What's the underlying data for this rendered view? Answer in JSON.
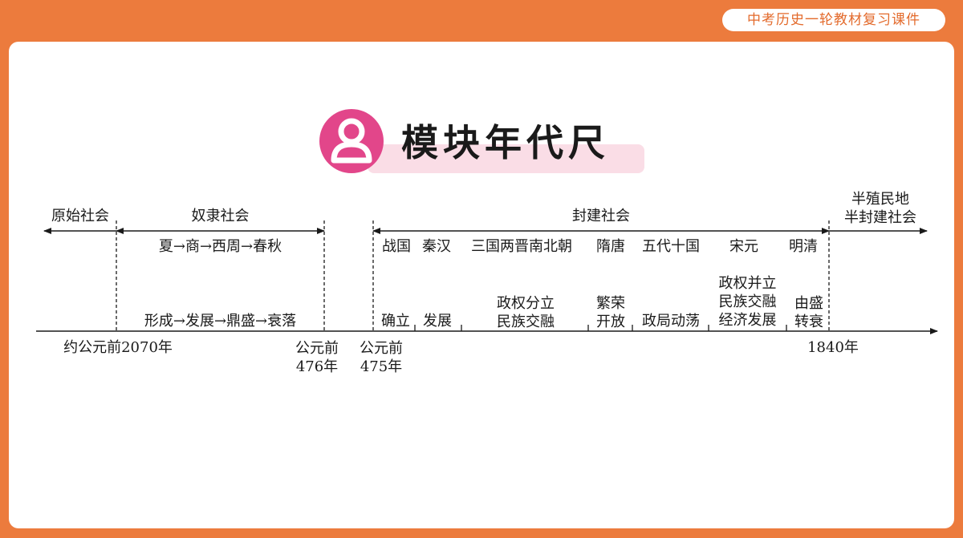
{
  "header": {
    "course_title": "中考历史一轮教材复习课件"
  },
  "module": {
    "icon": "person-icon",
    "title": "模块年代尺"
  },
  "timeline": {
    "societies": {
      "primitive": "原始社会",
      "slave": "奴隶社会",
      "feudal": "封建社会",
      "semi_colonial": [
        "半殖民地",
        "半封建社会"
      ]
    },
    "slave_dynasties": "夏→商→西周→春秋",
    "slave_stages": "形成→发展→鼎盛→衰落",
    "feudal_periods": [
      "战国",
      "秦汉",
      "三国两晋南北朝",
      "隋唐",
      "五代十国",
      "宋元",
      "明清"
    ],
    "feudal_stages": {
      "establish": "确立",
      "develop": "发展",
      "division": [
        "政权分立",
        "民族交融"
      ],
      "prosperity": [
        "繁荣",
        "开放"
      ],
      "turmoil": "政局动荡",
      "coexist": [
        "政权并立",
        "民族交融",
        "经济发展"
      ],
      "decline": [
        "由盛",
        "转衰"
      ]
    },
    "dates": {
      "start": "约公元前2070年",
      "bc476": [
        "公元前",
        "476年"
      ],
      "bc475": [
        "公元前",
        "475年"
      ],
      "ad1840": "1840年"
    }
  },
  "colors": {
    "frame": "#EC7B3D",
    "accent_pink": "#E2468A",
    "band_pink": "#FADDE6"
  }
}
